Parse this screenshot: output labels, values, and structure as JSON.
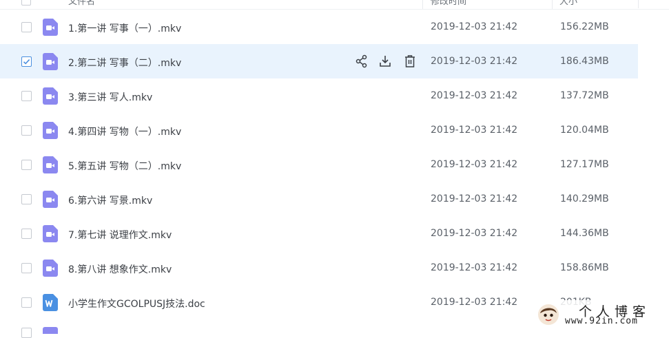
{
  "header": {
    "name_label": "文件名",
    "time_label": "修改时间",
    "size_label": "大小"
  },
  "files": [
    {
      "name": "1.第一讲 写事（一）.mkv",
      "time": "2019-12-03 21:42",
      "size": "156.22MB",
      "type": "video",
      "selected": false
    },
    {
      "name": "2.第二讲 写事（二）.mkv",
      "time": "2019-12-03 21:42",
      "size": "186.43MB",
      "type": "video",
      "selected": true
    },
    {
      "name": "3.第三讲 写人.mkv",
      "time": "2019-12-03 21:42",
      "size": "137.72MB",
      "type": "video",
      "selected": false
    },
    {
      "name": "4.第四讲 写物（一）.mkv",
      "time": "2019-12-03 21:42",
      "size": "120.04MB",
      "type": "video",
      "selected": false
    },
    {
      "name": "5.第五讲 写物（二）.mkv",
      "time": "2019-12-03 21:42",
      "size": "127.17MB",
      "type": "video",
      "selected": false
    },
    {
      "name": "6.第六讲 写景.mkv",
      "time": "2019-12-03 21:42",
      "size": "140.29MB",
      "type": "video",
      "selected": false
    },
    {
      "name": "7.第七讲 说理作文.mkv",
      "time": "2019-12-03 21:42",
      "size": "144.36MB",
      "type": "video",
      "selected": false
    },
    {
      "name": "8.第八讲 想象作文.mkv",
      "time": "2019-12-03 21:42",
      "size": "158.86MB",
      "type": "video",
      "selected": false
    },
    {
      "name": "小学生作文GCOLPUSJ技法.doc",
      "time": "2019-12-03 21:42",
      "size": "201KB",
      "type": "doc",
      "selected": false
    }
  ],
  "row_actions": [
    "share-icon",
    "download-icon",
    "delete-icon"
  ],
  "colors": {
    "selected_row_bg": "#e9f3fd",
    "video_icon": "#8b88f0",
    "doc_icon": "#4a90e2",
    "checkbox_checked": "#4a8fdf"
  },
  "watermark": {
    "title": "个人博客",
    "url": "www.92in.com"
  }
}
